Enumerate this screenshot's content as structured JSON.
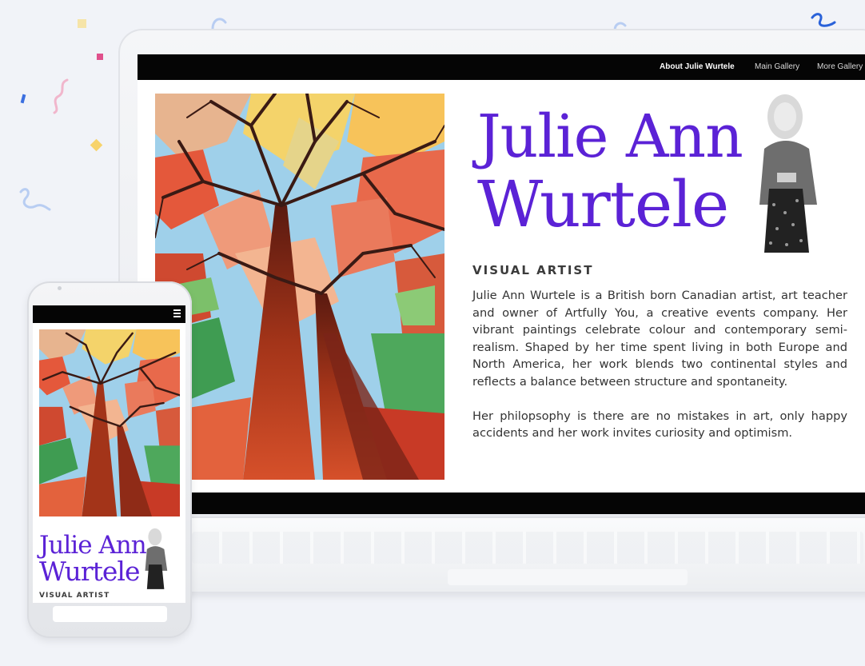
{
  "nav": {
    "items": [
      "About Julie Wurtele",
      "Main Gallery",
      "More Gallery"
    ],
    "active_index": 0
  },
  "artist": {
    "first_line": "Julie Ann",
    "second_line": "Wurtele",
    "subtitle": "VISUAL ARTIST",
    "bio_paragraphs": [
      "Julie Ann Wurtele is a British born Canadian artist, art teacher and owner of Artfully You, a creative events company.  Her vibrant paintings celebrate colour and contemporary semi-realism.  Shaped by her time spent living in both Europe and North America, her work blends two continental styles and reflects a balance between structure and spontaneity.",
      "Her philopsophy is there are no mistakes in art, only happy accidents and her work invites curiosity and optimism."
    ]
  },
  "mobile": {
    "first_line": "Julie Ann",
    "second_line": "Wurtele",
    "subtitle": "VISUAL ARTIST",
    "menu_icon": "hamburger-menu-icon"
  },
  "colors": {
    "name_purple": "#5b22d6",
    "nav_black": "#050505",
    "background": "#f1f3f8"
  }
}
